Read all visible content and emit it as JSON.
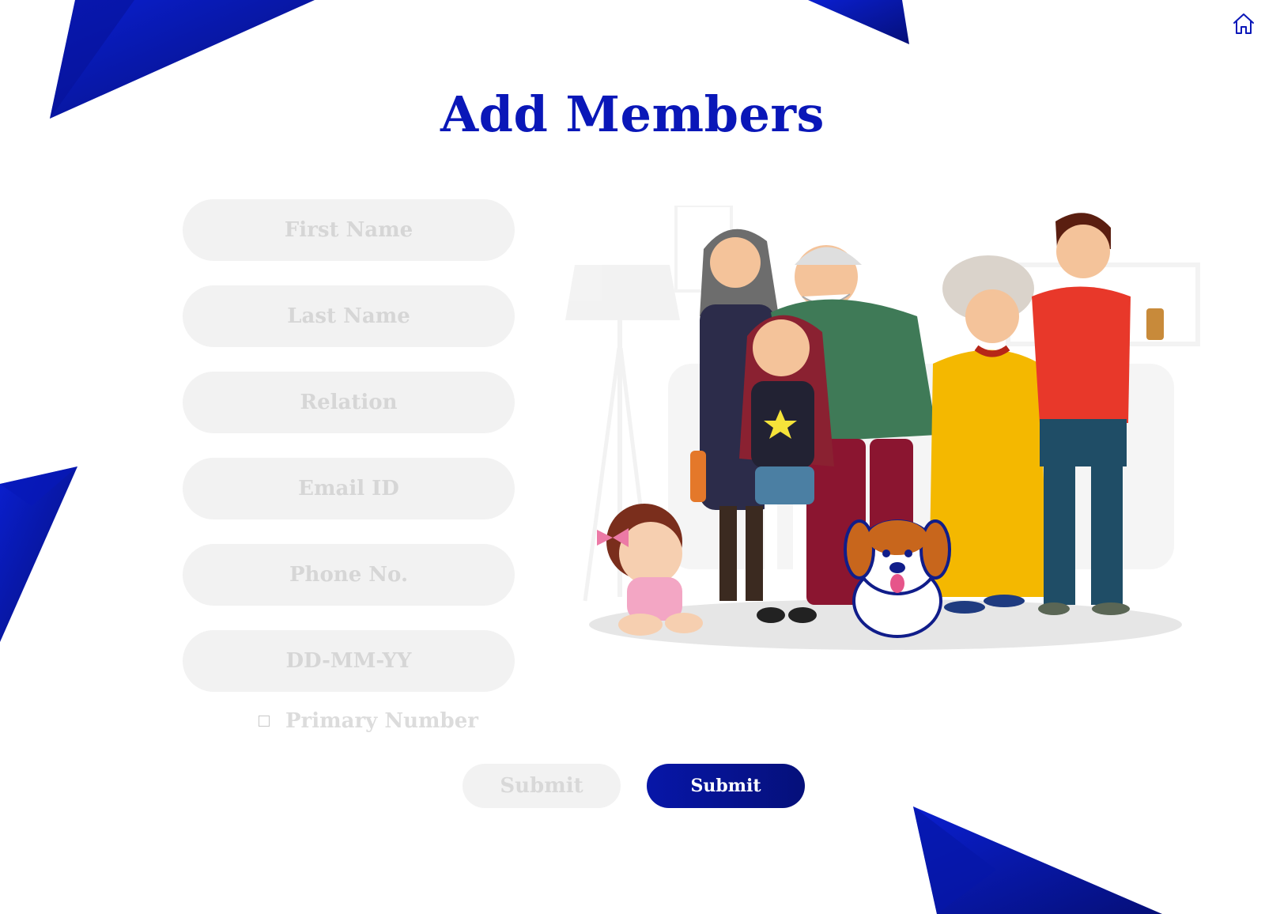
{
  "page": {
    "title": "Add Members"
  },
  "nav": {
    "home_icon": "home-icon"
  },
  "form": {
    "first_name": {
      "placeholder": "First Name",
      "value": ""
    },
    "last_name": {
      "placeholder": "Last Name",
      "value": ""
    },
    "relation": {
      "placeholder": "Relation",
      "value": ""
    },
    "email": {
      "placeholder": "Email ID",
      "value": ""
    },
    "phone": {
      "placeholder": "Phone No.",
      "value": ""
    },
    "dob": {
      "placeholder": "DD-MM-YY",
      "value": ""
    },
    "primary_number": {
      "label": "Primary Number",
      "checked": false
    }
  },
  "actions": {
    "secondary_label": "Submit",
    "primary_label": "Submit"
  },
  "theme": {
    "accent": "#0a17b8",
    "accent_dark": "#05107a",
    "field_bg": "#f2f2f2"
  },
  "illustration": {
    "icon": "family-illustration"
  }
}
